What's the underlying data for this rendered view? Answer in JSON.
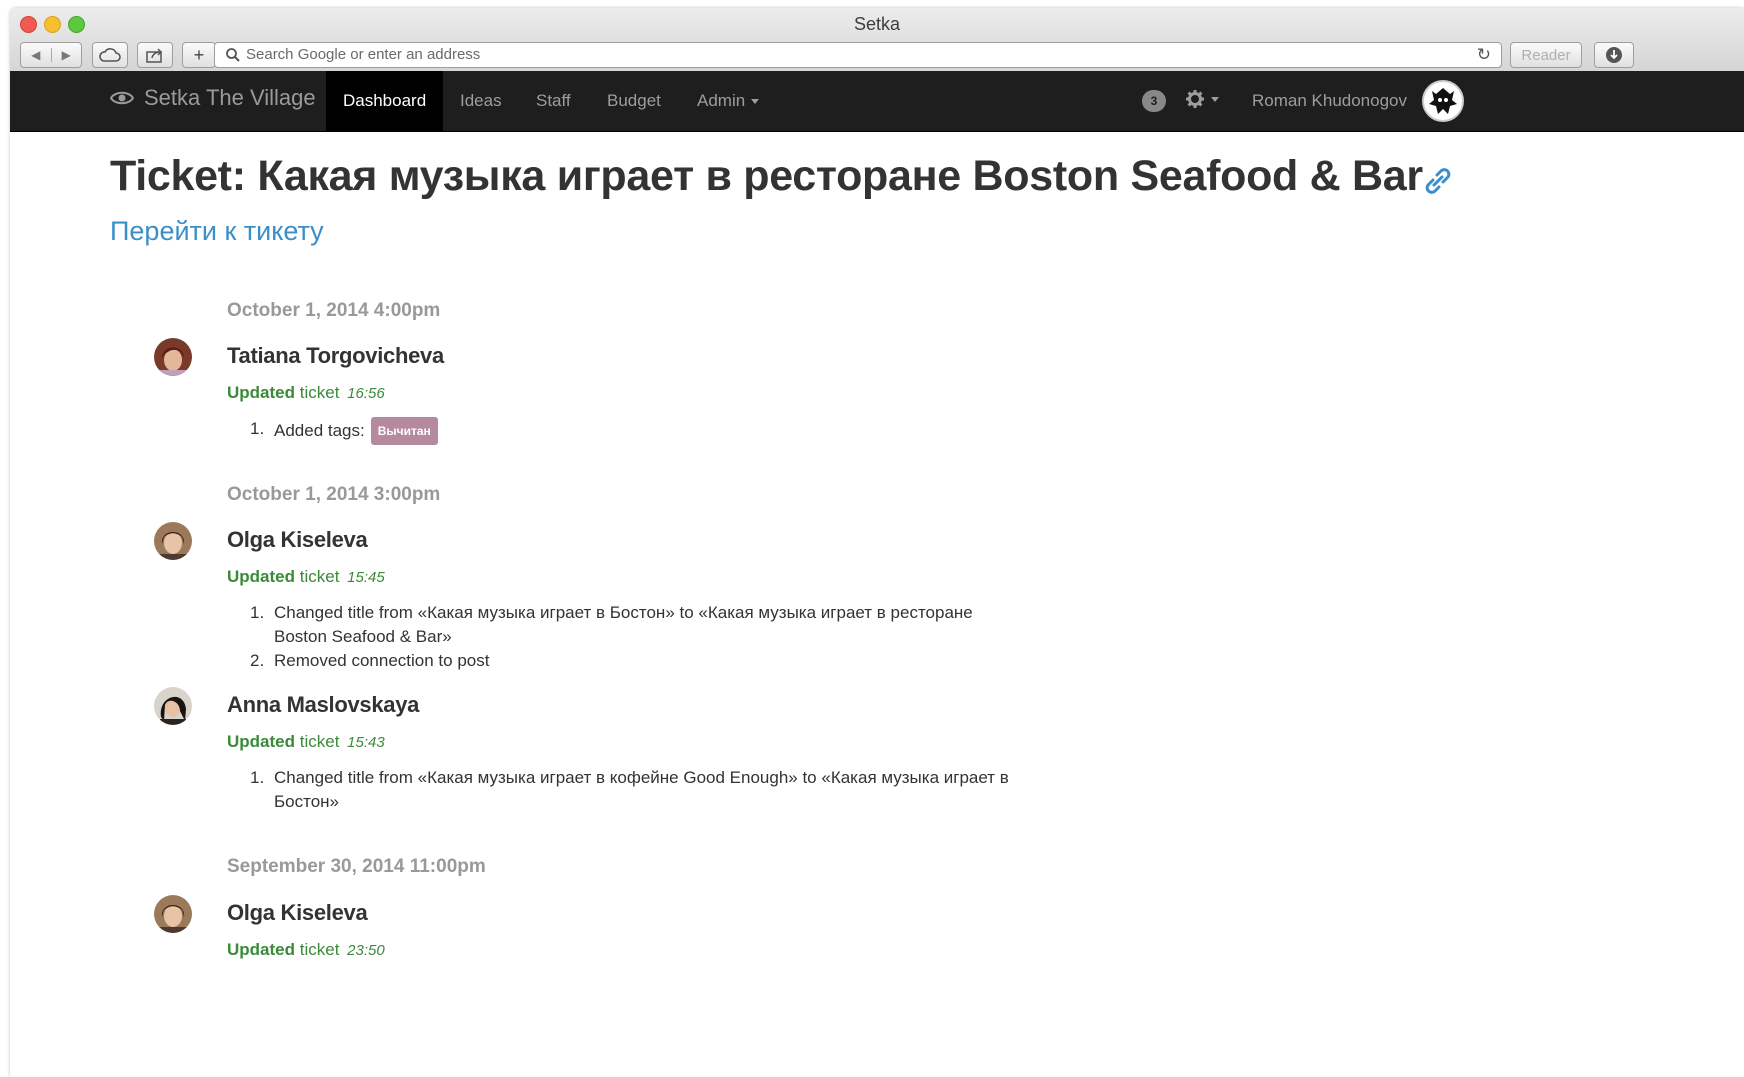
{
  "window": {
    "title": "Setka"
  },
  "toolbar": {
    "address_placeholder": "Search Google or enter an address",
    "reader_label": "Reader"
  },
  "navbar": {
    "brand": "Setka The Village",
    "items": [
      "Dashboard",
      "Ideas",
      "Staff",
      "Budget",
      "Admin"
    ],
    "active_item": "Dashboard",
    "notification_count": "3",
    "user_name": "Roman Khudonogov"
  },
  "page": {
    "title": "Ticket: Какая музыка играет в ресторане Boston Seafood & Bar",
    "go_to_ticket": "Перейти к тикету"
  },
  "timeline": [
    {
      "date": "October 1, 2014 4:00pm",
      "entries": [
        {
          "name": "Tatiana Torgovicheva",
          "action_verb": "Updated",
          "action_object": "ticket",
          "time": "16:56",
          "changes": [
            {
              "number": "1.",
              "text": "Added tags:",
              "tag": "Вычитан"
            }
          ]
        }
      ]
    },
    {
      "date": "October 1, 2014 3:00pm",
      "entries": [
        {
          "name": "Olga Kiseleva",
          "action_verb": "Updated",
          "action_object": "ticket",
          "time": "15:45",
          "changes": [
            {
              "number": "1.",
              "text": "Changed title from «Какая музыка играет в Бостон» to «Какая музыка играет в ресторане Boston Seafood & Bar»"
            },
            {
              "number": "2.",
              "text": "Removed connection to post"
            }
          ]
        },
        {
          "name": "Anna Maslovskaya",
          "action_verb": "Updated",
          "action_object": "ticket",
          "time": "15:43",
          "changes": [
            {
              "number": "1.",
              "text": "Changed title from «Какая музыка играет в кофейне Good Enough» to «Какая музыка играет в Бостон»"
            }
          ]
        }
      ]
    },
    {
      "date": "September 30, 2014 11:00pm",
      "entries": [
        {
          "name": "Olga Kiseleva",
          "action_verb": "Updated",
          "action_object": "ticket",
          "time": "23:50",
          "changes": []
        }
      ]
    }
  ],
  "colors": {
    "navbar_bg": "#1e1e1e",
    "link_blue": "#3a8fc8",
    "action_green": "#3a8a3a",
    "tag_bg": "#b58a9e",
    "date_gray": "#999999"
  },
  "icons": [
    "eye-icon",
    "gear-icon",
    "link-icon",
    "search-icon",
    "reload-icon",
    "cloud-icon",
    "share-icon"
  ]
}
